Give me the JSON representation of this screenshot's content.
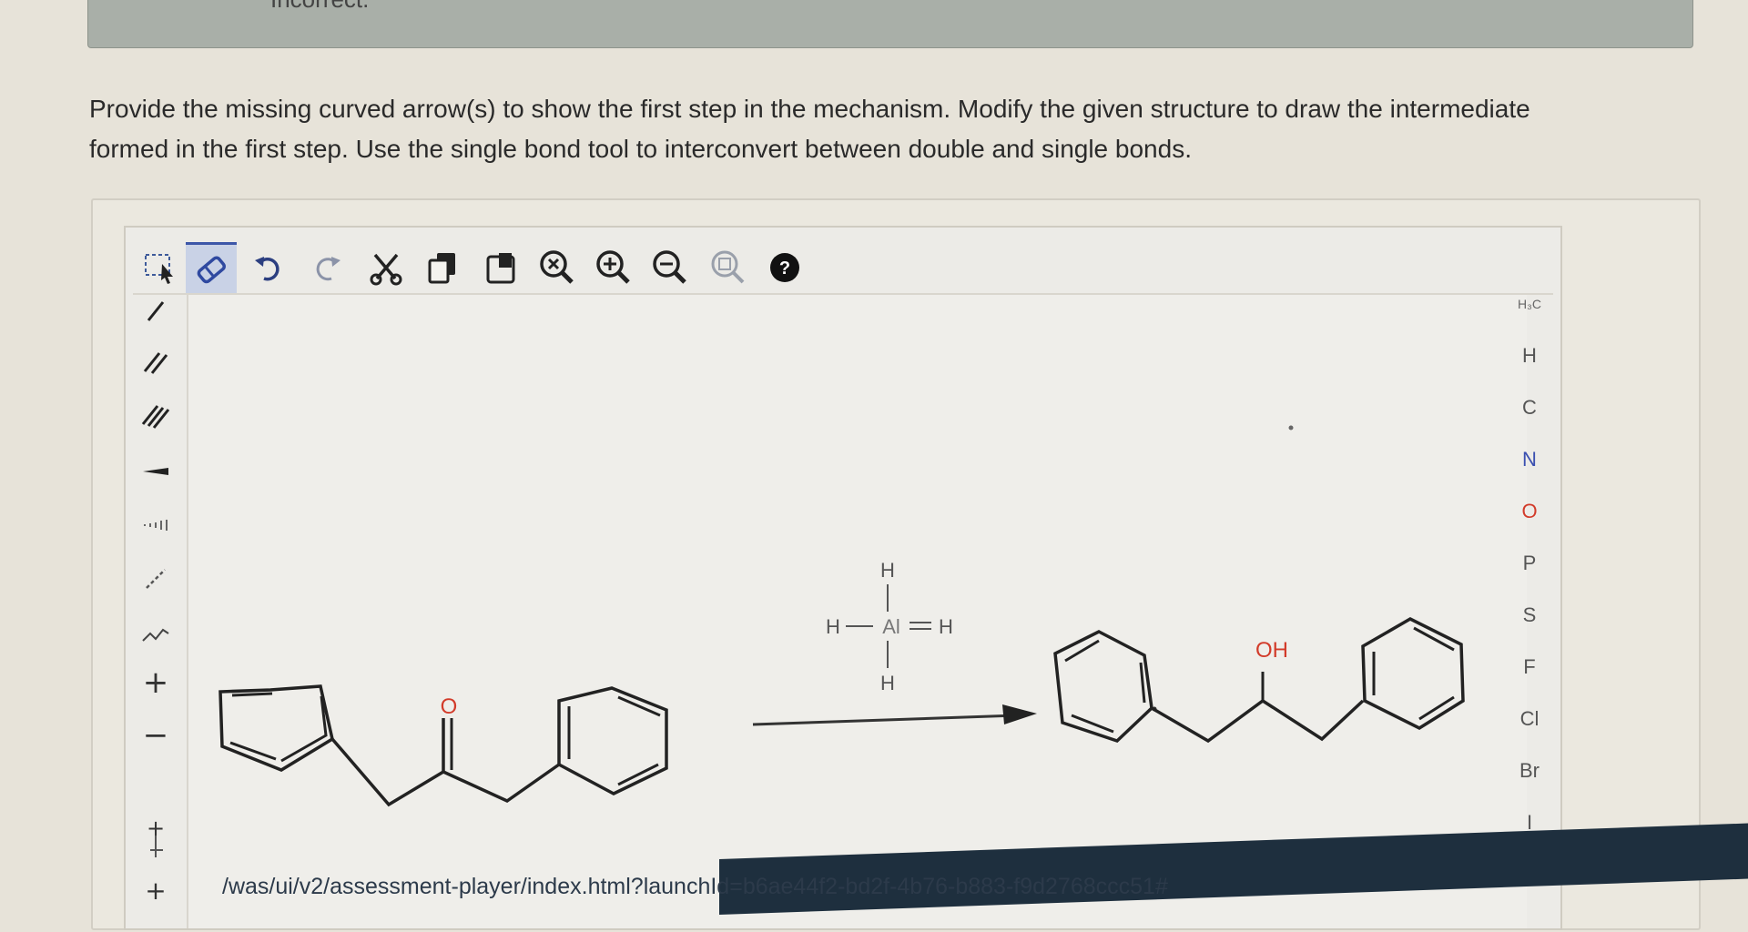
{
  "banner": {
    "text": "Incorrect."
  },
  "question": {
    "line1": "Provide the missing curved arrow(s) to show the first step in the mechanism. Modify the given structure to draw the intermediate",
    "line2": "formed in the first step. Use the single bond tool to interconvert between double and single bonds."
  },
  "toolbar": {
    "tools": [
      {
        "name": "select-icon"
      },
      {
        "name": "eraser-icon",
        "active": true
      },
      {
        "name": "undo-icon"
      },
      {
        "name": "redo-icon"
      },
      {
        "name": "cut-icon"
      },
      {
        "name": "copy-icon"
      },
      {
        "name": "paste-icon"
      },
      {
        "name": "zoom-reset-icon"
      },
      {
        "name": "zoom-in-icon"
      },
      {
        "name": "zoom-out-icon"
      },
      {
        "name": "zoom-fit-icon"
      },
      {
        "name": "help-icon"
      }
    ],
    "active_color": "#3d57a8"
  },
  "left_tools": {
    "plus_label": "+",
    "minus_label": "−",
    "radical_plus": "+",
    "bottom_plus": "+"
  },
  "elements": {
    "header": "H₃C",
    "items": [
      "H",
      "C",
      "N",
      "O",
      "P",
      "S",
      "F",
      "Cl",
      "Br",
      "I"
    ],
    "colors": {
      "N": "#3a4fb0",
      "O": "#d23b2a",
      "default": "#555555"
    }
  },
  "reagent": {
    "center": "Al",
    "top": "H",
    "bottom": "H",
    "left": "H",
    "right": "H"
  },
  "reactant": {
    "carbonyl_o": "O"
  },
  "product": {
    "hydroxyl": "OH"
  },
  "url": "/was/ui/v2/assessment-player/index.html?launchId=b6ae44f2-bd2f-4b76-b883-f9d2768ccc51#"
}
